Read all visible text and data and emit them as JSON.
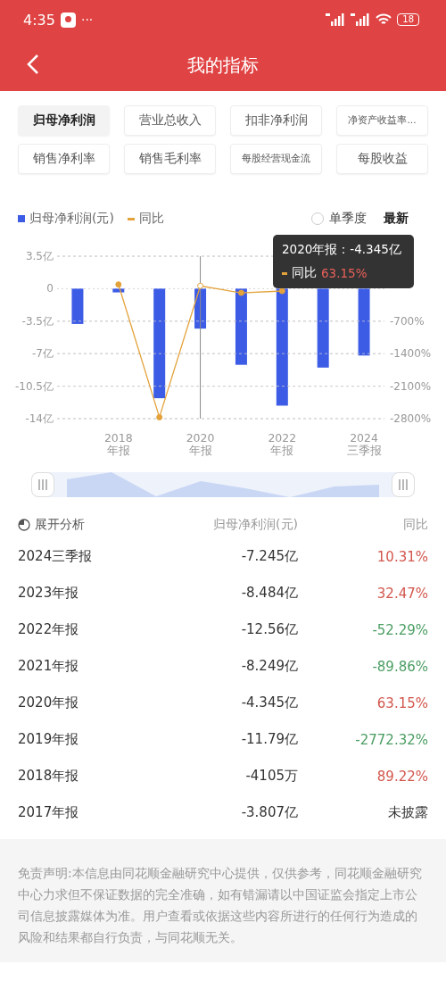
{
  "status_bar": {
    "time": "4:35",
    "more": "···",
    "battery": "18"
  },
  "header": {
    "title": "我的指标"
  },
  "tabs": [
    {
      "label": "归母净利润",
      "selected": true
    },
    {
      "label": "营业总收入",
      "selected": false
    },
    {
      "label": "扣非净利润",
      "selected": false
    },
    {
      "label": "净资产收益率...",
      "selected": false
    },
    {
      "label": "销售净利率",
      "selected": false
    },
    {
      "label": "销售毛利率",
      "selected": false
    },
    {
      "label": "每股经营现金流",
      "selected": false
    },
    {
      "label": "每股收益",
      "selected": false
    }
  ],
  "chart_controls": {
    "single_quarter": {
      "label": "单季度",
      "checked": false
    },
    "latest": "最新"
  },
  "chart": {
    "chart_data": {
      "type": "bar",
      "categories": [
        null,
        "2018\n年报",
        null,
        "2020\n年报",
        null,
        "2022\n年报",
        null,
        "2024\n三季报"
      ],
      "series": [
        {
          "name": "归母净利润(元)",
          "color": "#3d5ce6",
          "values": [
            -3.8,
            -0.4,
            -11.8,
            -4.3,
            -8.2,
            -12.6,
            -8.5,
            -7.2
          ]
        }
      ],
      "ylim": [
        -14,
        3.5
      ],
      "yticks": [
        {
          "value": 3.5,
          "label": "3.5亿"
        },
        {
          "value": 0,
          "label": "0"
        },
        {
          "value": -3.5,
          "label": "-3.5亿"
        },
        {
          "value": -7,
          "label": "-7亿"
        },
        {
          "value": -10.5,
          "label": "-10.5亿"
        },
        {
          "value": -14,
          "label": "-14亿"
        }
      ],
      "grid": true,
      "annotations": [
        "2020年报：-4.345亿"
      ]
    },
    "points": [
      {
        "selected": false
      },
      {
        "selected": false
      },
      {
        "selected": false
      },
      {
        "selected": true
      },
      {
        "selected": false
      },
      {
        "selected": false
      },
      {
        "selected": false
      },
      {
        "selected": false
      }
    ],
    "yoy": {
      "chart_data": {
        "type": "line",
        "series": [
          {
            "name": "同比",
            "color": "#e3a23a",
            "marker": true,
            "values": [
              null,
              90,
              -2770,
              60,
              -90,
              -50,
              null,
              null
            ]
          }
        ],
        "ylim": [
          -2800,
          700
        ],
        "grid": true,
        "yticks": [
          {
            "value": -700,
            "label": "-700%"
          },
          {
            "value": -1400,
            "label": "-1400%"
          },
          {
            "value": -2100,
            "label": "-2100%"
          },
          {
            "value": -2800,
            "label": "-2800%"
          }
        ]
      }
    },
    "tooltip": {
      "label": "同比",
      "value": "63.15%"
    }
  },
  "table": {
    "expand": "展开分析",
    "columns": [
      "归母净利润(元)",
      "同比"
    ],
    "rows": [
      {
        "period": "2024三季报",
        "value": "-7.245亿",
        "yoy": "10.31%",
        "color": "#d2564c"
      },
      {
        "period": "2023年报",
        "value": "-8.484亿",
        "yoy": "32.47%",
        "color": "#d2564c"
      },
      {
        "period": "2022年报",
        "value": "-12.56亿",
        "yoy": "-52.29%",
        "color": "#4a9d62"
      },
      {
        "period": "2021年报",
        "value": "-8.249亿",
        "yoy": "-89.86%",
        "color": "#4a9d62"
      },
      {
        "period": "2020年报",
        "value": "-4.345亿",
        "yoy": "63.15%",
        "color": "#d2564c"
      },
      {
        "period": "2019年报",
        "value": "-11.79亿",
        "yoy": "-2772.32%",
        "color": "#4a9d62"
      },
      {
        "period": "2018年报",
        "value": "-4105万",
        "yoy": "89.22%",
        "color": "#d2564c"
      },
      {
        "period": "2017年报",
        "value": "-3.807亿",
        "yoy": "未披露",
        "color": "#333333"
      }
    ]
  },
  "disclaimer": "免责声明:本信息由同花顺金融研究中心提供，仅供参考，同花顺金融研究中心力求但不保证数据的完全准确，如有错漏请以中国证监会指定上市公司信息披露媒体为准。用户查看或依据这些内容所进行的任何行为造成的风险和结果都自行负责，与同花顺无关。"
}
